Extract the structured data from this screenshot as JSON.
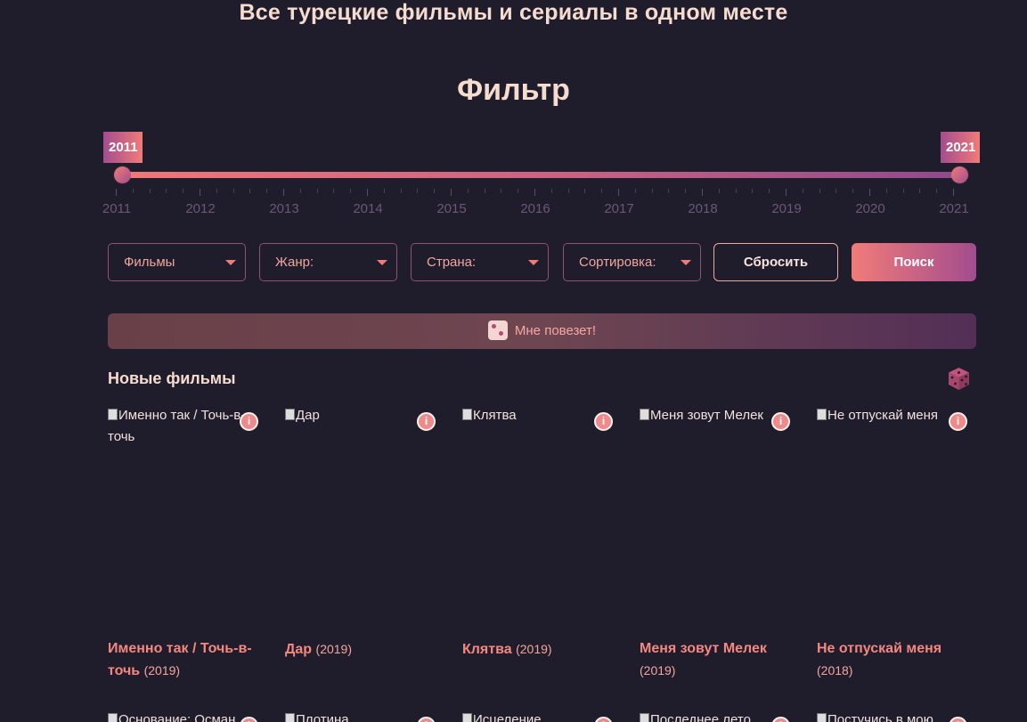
{
  "header": {
    "title": "Все турецкие фильмы и сериалы в одном месте"
  },
  "filter": {
    "title": "Фильтр",
    "year_slider": {
      "from": "2011",
      "to": "2021",
      "tick_labels": [
        "2011",
        "2012",
        "2013",
        "2014",
        "2015",
        "2016",
        "2017",
        "2018",
        "2019",
        "2020",
        "2021"
      ]
    },
    "selects": [
      {
        "label": "Фильмы"
      },
      {
        "label": "Жанр:"
      },
      {
        "label": "Страна:"
      },
      {
        "label": "Сортировка:"
      }
    ],
    "reset_label": "Сбросить",
    "search_label": "Поиск",
    "lucky_label": "Мне повезет!"
  },
  "new_movies": {
    "title": "Новые фильмы",
    "cards": [
      {
        "alt": "Именно так / Точь-в-точь",
        "name": "Именно так / Точь-в-точь",
        "year": "(2019)"
      },
      {
        "alt": "Дар",
        "name": "Дар",
        "year": "(2019)"
      },
      {
        "alt": "Клятва",
        "name": "Клятва",
        "year": "(2019)"
      },
      {
        "alt": "Меня зовут Мелек",
        "name": "Меня зовут Мелек",
        "year": "(2019)"
      },
      {
        "alt": "Не отпускай меня",
        "name": "Не отпускай меня",
        "year": "(2018)"
      }
    ],
    "next_row_alts": [
      "Основание: Осман",
      "Плотина",
      "Исцеление",
      "Последнее лето",
      "Постучись в мою"
    ]
  },
  "colors": {
    "background": "#1f1c2b",
    "accent_start": "#f07b79",
    "accent_end": "#a34d8e"
  }
}
